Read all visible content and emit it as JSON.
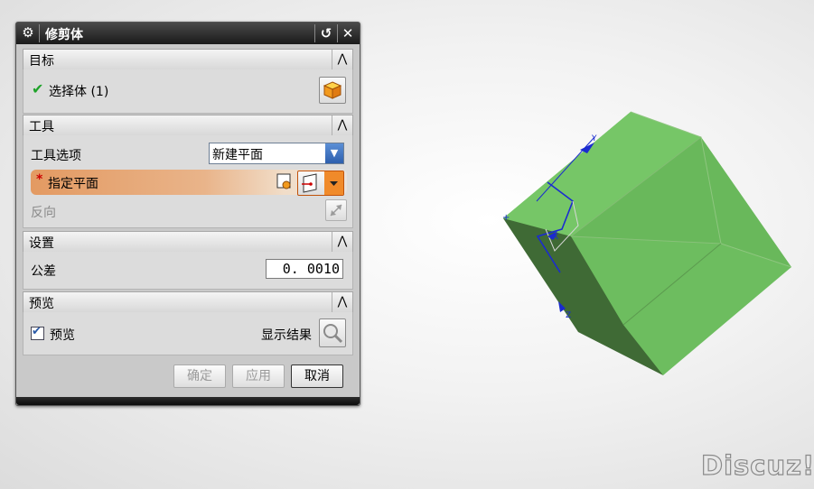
{
  "dialog": {
    "title": "修剪体",
    "icons": {
      "settings": "gear-icon",
      "reset": "reset-icon",
      "close": "close-icon"
    }
  },
  "sections": {
    "target": {
      "label": "目标",
      "select_body_label": "选择体 (1)",
      "icons": {
        "collapse": "chevron-up-icon",
        "status": "green-check-icon",
        "select": "solid-body-icon"
      }
    },
    "tool": {
      "label": "工具",
      "tool_option_label": "工具选项",
      "tool_option_value": "新建平面",
      "required_marker": "*",
      "specify_plane_label": "指定平面",
      "reverse_label": "反向",
      "icons": {
        "plane_dialog": "plane-dialog-icon",
        "plane_type": "plane-type-icon",
        "reverse": "reverse-direction-icon"
      }
    },
    "settings": {
      "label": "设置",
      "tolerance_label": "公差",
      "tolerance_value": "0. 0010"
    },
    "preview": {
      "label": "预览",
      "preview_label": "预览",
      "preview_checked": true,
      "show_result_label": "显示结果",
      "icons": {
        "show_result": "magnifier-icon"
      }
    }
  },
  "buttons": {
    "ok": "确定",
    "apply": "应用",
    "cancel": "取消"
  },
  "viewport": {
    "axis_labels": {
      "x": "X",
      "y": "Y",
      "z": "Z"
    },
    "body_color": "#6dbd5f"
  },
  "watermark": "Discuz!"
}
